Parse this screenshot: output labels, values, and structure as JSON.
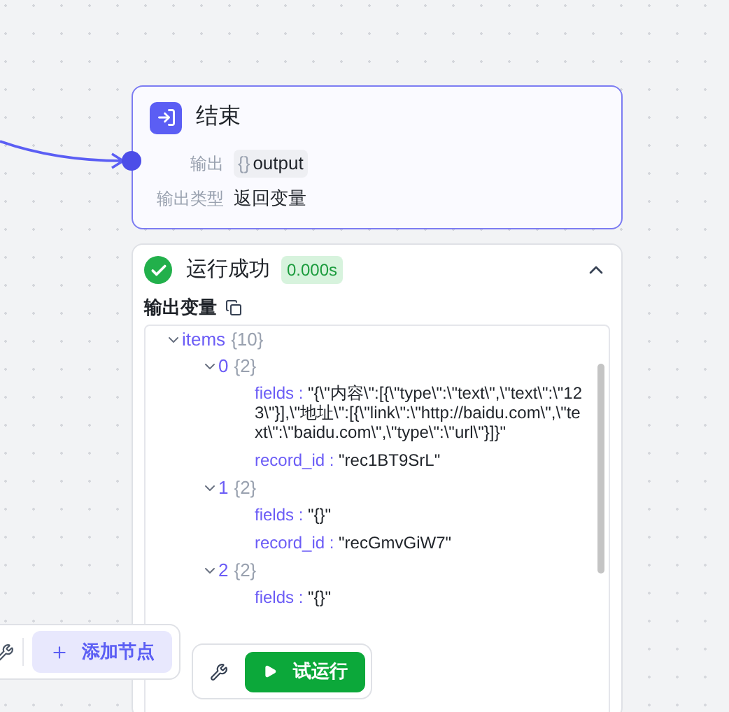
{
  "end_node": {
    "title": "结束",
    "fields": [
      {
        "label": "输出",
        "kind": "variable",
        "icon": "{}",
        "value": "output"
      },
      {
        "label": "输出类型",
        "kind": "text",
        "value": "返回变量"
      }
    ]
  },
  "result": {
    "status": "运行成功",
    "duration": "0.000s",
    "expanded": true,
    "output_label": "输出变量",
    "tree": [
      {
        "key": "items",
        "count": "{10}",
        "expanded": true,
        "children": [
          {
            "key": "0",
            "count": "{2}",
            "expanded": true,
            "children": [
              {
                "key": "fields :",
                "value": "\"{\\\"内容\\\":[{\\\"type\\\":\\\"text\\\",\\\"text\\\":\\\"123\\\"}],\\\"地址\\\":[{\\\"link\\\":\\\"http://baidu.com\\\",\\\"text\\\":\\\"baidu.com\\\",\\\"type\\\":\\\"url\\\"}]}\""
              },
              {
                "key": "record_id :",
                "value": "\"rec1BT9SrL\""
              }
            ]
          },
          {
            "key": "1",
            "count": "{2}",
            "expanded": true,
            "children": [
              {
                "key": "fields :",
                "value": "\"{}\""
              },
              {
                "key": "record_id :",
                "value": "\"recGmvGiW7\""
              }
            ]
          },
          {
            "key": "2",
            "count": "{2}",
            "expanded": true,
            "children": [
              {
                "key": "fields :",
                "value": "\"{}\""
              }
            ]
          }
        ]
      }
    ]
  },
  "toolbar": {
    "add_node": "添加节点",
    "test_run": "试运行"
  }
}
